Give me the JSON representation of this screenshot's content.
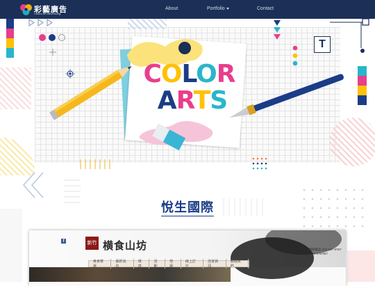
{
  "navbar": {
    "brand_name": "彩藝廣告",
    "brand_sub": "Colors Art Advertising",
    "links": [
      {
        "label": "About"
      },
      {
        "label": "Portfolio"
      },
      {
        "label": "Contact"
      }
    ]
  },
  "hero": {
    "word1": "COLOR",
    "word2": "ARTS",
    "letter_colors": [
      "#e83e8c",
      "#ffc107",
      "#1b3d86",
      "#29b6c9",
      "#e83e8c"
    ],
    "badge_letter": "T"
  },
  "section": {
    "title": "悅生國際"
  },
  "preview": {
    "facebook_icon": "f",
    "badge_text": "新竹",
    "shop_name": "横食山坊",
    "menu": [
      "美食菜單",
      "最新消息",
      "環境",
      "活動",
      "地圖",
      "線上訂位",
      "店家資訊",
      "聯絡我們"
    ],
    "contact_line1": "聯絡電話 (03) 547-9767",
    "contact_line2": "0929-579-067"
  },
  "colors": {
    "navbar": "#1b2f57",
    "title": "#1b3d86",
    "pink": "#e83e8c",
    "yellow": "#ffc107",
    "cyan": "#29b6c9",
    "navy": "#1b3d86"
  }
}
